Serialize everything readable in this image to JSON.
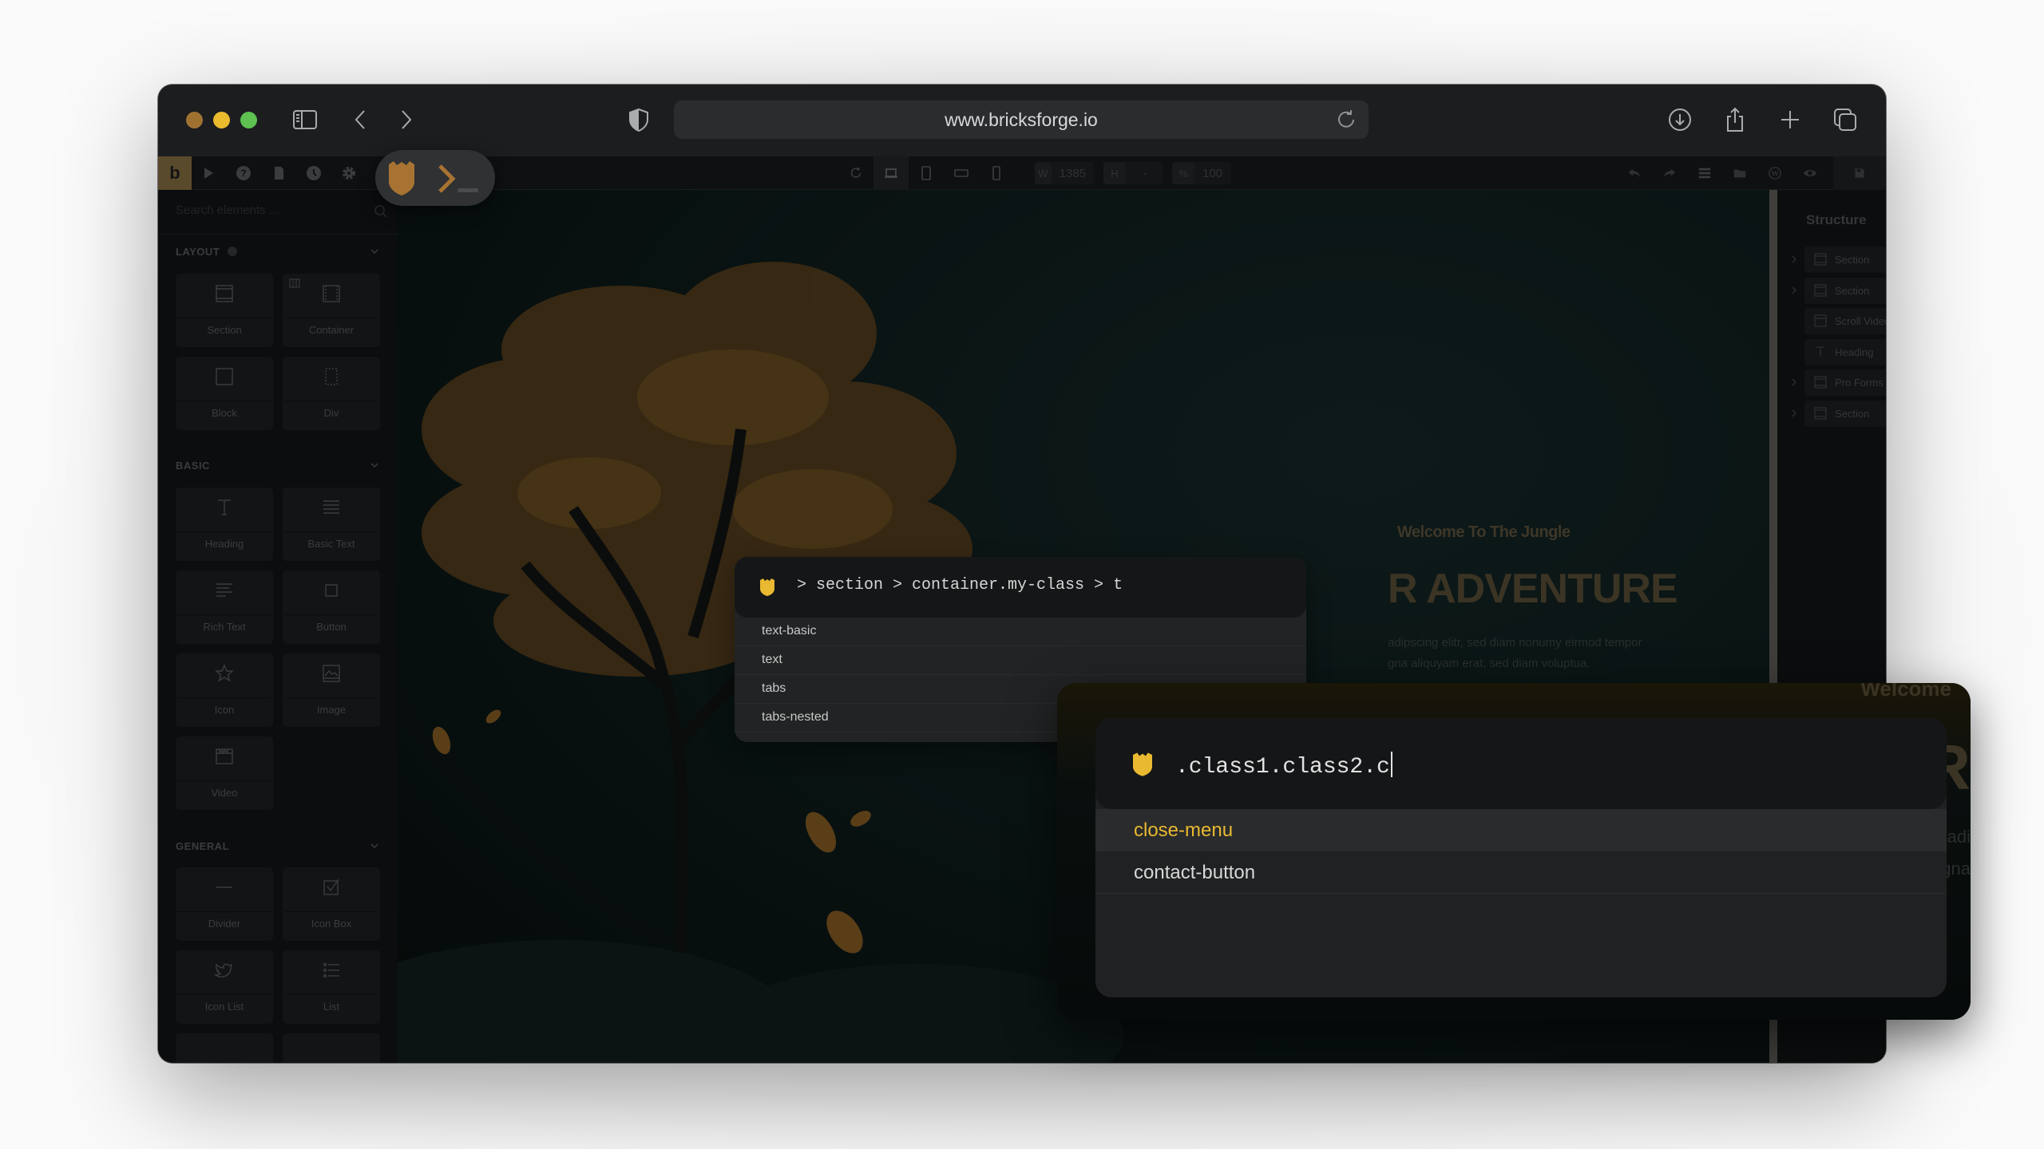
{
  "browser": {
    "url": "www.bricksforge.io",
    "icons": {
      "sidebar": "sidebar-toggle-icon",
      "back": "chevron-left-icon",
      "forward": "chevron-right-icon",
      "privacy": "shield-icon",
      "reload": "reload-icon",
      "download": "download-icon",
      "share": "share-icon",
      "new_tab": "plus-icon",
      "tabs": "tabs-overview-icon"
    },
    "traffic_colors": {
      "close": "#a07232",
      "minimize": "#e9bb2d",
      "maximize": "#5ec151"
    }
  },
  "builder_toolbar": {
    "logo": "b",
    "left_icons": [
      "pointer-icon",
      "help-icon",
      "pages-icon",
      "history-icon",
      "settings-icon"
    ],
    "dimensions": {
      "width_label": "W",
      "width_value": "1385",
      "height_label": "H",
      "height_value": "-",
      "zoom_label": "%",
      "zoom_value": "100"
    },
    "right_icons": [
      "undo-icon",
      "redo-icon",
      "menu-icon",
      "folder-icon",
      "wordpress-icon",
      "preview-icon",
      "save-icon"
    ]
  },
  "accent_color": "#e8b931",
  "sidebar": {
    "search_placeholder": "Search elements ...",
    "groups": [
      {
        "title": "LAYOUT",
        "items": [
          "Section",
          "Container",
          "Block",
          "Div"
        ]
      },
      {
        "title": "BASIC",
        "items": [
          "Heading",
          "Basic Text",
          "Rich Text",
          "Button",
          "Icon",
          "Image",
          "Video"
        ]
      },
      {
        "title": "GENERAL",
        "items": [
          "Divider",
          "Icon Box",
          "Icon List",
          "List"
        ]
      }
    ]
  },
  "canvas": {
    "subheading": "Welcome To The Jungle",
    "heading": "R ADVENTURE",
    "body_line1": "adipscing elitr, sed diam nonumy eirmod tempor",
    "body_line2": "gna aliquyam erat, sed diam voluptua."
  },
  "structure": {
    "title": "Structure",
    "rows": [
      {
        "label": "Section",
        "expandable": true
      },
      {
        "label": "Section",
        "expandable": true
      },
      {
        "label": "Scroll Video",
        "expandable": false
      },
      {
        "label": "Heading",
        "expandable": false
      },
      {
        "label": "Pro Forms",
        "expandable": true
      },
      {
        "label": "Section",
        "expandable": true
      }
    ]
  },
  "palette_selector": {
    "query": "> section > container.my-class > t",
    "suggestions": [
      "text-basic",
      "text",
      "tabs",
      "tabs-nested"
    ]
  },
  "palette_class": {
    "query": ".class1.class2.c",
    "suggestions": [
      {
        "label": "close-menu",
        "selected": true
      },
      {
        "label": "contact-button",
        "selected": false
      }
    ],
    "preview_welcome": "Welcome",
    "preview_letter": "R",
    "preview_text1": "adi",
    "preview_text2": "gna"
  }
}
